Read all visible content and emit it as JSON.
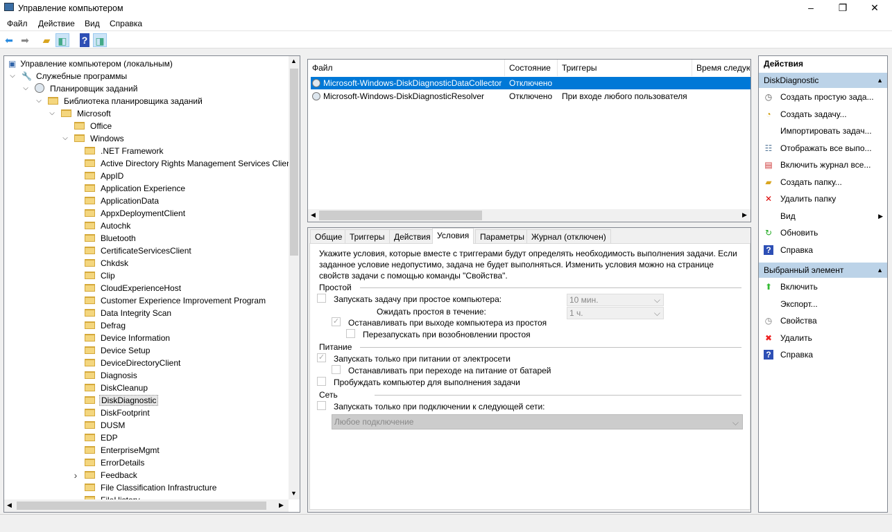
{
  "window": {
    "title": "Управление компьютером",
    "minimize": "–",
    "maximize": "❐",
    "close": "✕"
  },
  "menu": [
    "Файл",
    "Действие",
    "Вид",
    "Справка"
  ],
  "toolbar": {
    "icons": [
      "back-icon",
      "forward-icon",
      "up-folder-icon",
      "show-hide-tree-icon",
      "help-icon",
      "show-hide-actions-icon"
    ]
  },
  "tree": [
    {
      "label": "Управление компьютером (локальным)",
      "level": 0,
      "icon": "computer"
    },
    {
      "label": "Служебные программы",
      "level": 1,
      "icon": "tools",
      "expanded": true
    },
    {
      "label": "Планировщик заданий",
      "level": 2,
      "icon": "clock",
      "expanded": true
    },
    {
      "label": "Библиотека планировщика заданий",
      "level": 3,
      "icon": "folder-clock",
      "expanded": true
    },
    {
      "label": "Microsoft",
      "level": 4,
      "icon": "folder",
      "expanded": true
    },
    {
      "label": "Office",
      "level": 5,
      "icon": "folder"
    },
    {
      "label": "Windows",
      "level": 5,
      "icon": "folder",
      "expanded": true
    },
    {
      "label": ".NET Framework",
      "level": 6,
      "icon": "folder"
    },
    {
      "label": "Active Directory Rights Management Services Client",
      "level": 6,
      "icon": "folder"
    },
    {
      "label": "AppID",
      "level": 6,
      "icon": "folder"
    },
    {
      "label": "Application Experience",
      "level": 6,
      "icon": "folder"
    },
    {
      "label": "ApplicationData",
      "level": 6,
      "icon": "folder"
    },
    {
      "label": "AppxDeploymentClient",
      "level": 6,
      "icon": "folder"
    },
    {
      "label": "Autochk",
      "level": 6,
      "icon": "folder"
    },
    {
      "label": "Bluetooth",
      "level": 6,
      "icon": "folder"
    },
    {
      "label": "CertificateServicesClient",
      "level": 6,
      "icon": "folder"
    },
    {
      "label": "Chkdsk",
      "level": 6,
      "icon": "folder"
    },
    {
      "label": "Clip",
      "level": 6,
      "icon": "folder"
    },
    {
      "label": "CloudExperienceHost",
      "level": 6,
      "icon": "folder"
    },
    {
      "label": "Customer Experience Improvement Program",
      "level": 6,
      "icon": "folder"
    },
    {
      "label": "Data Integrity Scan",
      "level": 6,
      "icon": "folder"
    },
    {
      "label": "Defrag",
      "level": 6,
      "icon": "folder"
    },
    {
      "label": "Device Information",
      "level": 6,
      "icon": "folder"
    },
    {
      "label": "Device Setup",
      "level": 6,
      "icon": "folder"
    },
    {
      "label": "DeviceDirectoryClient",
      "level": 6,
      "icon": "folder"
    },
    {
      "label": "Diagnosis",
      "level": 6,
      "icon": "folder"
    },
    {
      "label": "DiskCleanup",
      "level": 6,
      "icon": "folder"
    },
    {
      "label": "DiskDiagnostic",
      "level": 6,
      "icon": "folder",
      "selected": true
    },
    {
      "label": "DiskFootprint",
      "level": 6,
      "icon": "folder"
    },
    {
      "label": "DUSM",
      "level": 6,
      "icon": "folder"
    },
    {
      "label": "EDP",
      "level": 6,
      "icon": "folder"
    },
    {
      "label": "EnterpriseMgmt",
      "level": 6,
      "icon": "folder"
    },
    {
      "label": "ErrorDetails",
      "level": 6,
      "icon": "folder"
    },
    {
      "label": "Feedback",
      "level": 6,
      "icon": "folder",
      "expanded": false
    },
    {
      "label": "File Classification Infrastructure",
      "level": 6,
      "icon": "folder"
    },
    {
      "label": "FileHistory",
      "level": 6,
      "icon": "folder"
    }
  ],
  "tasks": {
    "columns": [
      "Файл",
      "Состояние",
      "Триггеры",
      "Время следую"
    ],
    "rows": [
      {
        "name": "Microsoft-Windows-DiskDiagnosticDataCollector",
        "state": "Отключено",
        "triggers": "",
        "selected": true
      },
      {
        "name": "Microsoft-Windows-DiskDiagnosticResolver",
        "state": "Отключено",
        "triggers": "При входе любого пользователя"
      }
    ]
  },
  "tabs": [
    {
      "label": "Общие"
    },
    {
      "label": "Триггеры"
    },
    {
      "label": "Действия"
    },
    {
      "label": "Условия",
      "active": true
    },
    {
      "label": "Параметры"
    },
    {
      "label": "Журнал (отключен)"
    }
  ],
  "conditions": {
    "intro": [
      "Укажите условия, которые вместе с триггерами будут определять необходимость выполнения задачи.  Если",
      "заданное условие недопустимо, задача не будет выполняться.  Изменить условия можно на странице",
      "свойств задачи с помощью команды \"Свойства\"."
    ],
    "idle": {
      "title": "Простой",
      "start_idle": {
        "label": "Запускать задачу при простое компьютера:",
        "checked": false,
        "value": "10 мин."
      },
      "wait_label": "Ожидать простоя в течение:",
      "wait_value": "1 ч.",
      "stop_on_exit": {
        "label": "Останавливать при выходе компьютера из простоя",
        "checked": true
      },
      "restart": {
        "label": "Перезапускать при возобновлении простоя",
        "checked": false
      }
    },
    "power": {
      "title": "Питание",
      "ac_only": {
        "label": "Запускать только при питании от электросети",
        "checked": true
      },
      "stop_battery": {
        "label": "Останавливать при переходе на питание от батарей",
        "checked": false
      },
      "wake": {
        "label": "Пробуждать компьютер для выполнения задачи",
        "checked": false
      }
    },
    "network": {
      "title": "Сеть",
      "only_network": {
        "label": "Запускать только при подключении к следующей сети:",
        "checked": false
      },
      "network_value": "Любое подключение"
    }
  },
  "actions": {
    "title": "Действия",
    "section1": {
      "title": "DiskDiagnostic",
      "items": [
        {
          "label": "Создать простую зада...",
          "icon": "create-basic-task-icon"
        },
        {
          "label": "Создать задачу...",
          "icon": "create-task-icon"
        },
        {
          "label": "Импортировать задач...",
          "icon": ""
        },
        {
          "label": "Отображать все выпо...",
          "icon": "display-running-icon"
        },
        {
          "label": "Включить журнал все...",
          "icon": "enable-log-icon"
        },
        {
          "label": "Создать папку...",
          "icon": "new-folder-icon"
        },
        {
          "label": "Удалить папку",
          "icon": "delete-folder-icon"
        },
        {
          "label": "Вид",
          "icon": "",
          "submenu": true
        },
        {
          "label": "Обновить",
          "icon": "refresh-icon"
        },
        {
          "label": "Справка",
          "icon": "help-icon"
        }
      ]
    },
    "section2": {
      "title": "Выбранный элемент",
      "items": [
        {
          "label": "Включить",
          "icon": "enable-icon"
        },
        {
          "label": "Экспорт...",
          "icon": ""
        },
        {
          "label": "Свойства",
          "icon": "properties-icon"
        },
        {
          "label": "Удалить",
          "icon": "delete-icon"
        },
        {
          "label": "Справка",
          "icon": "help-icon"
        }
      ]
    }
  },
  "colors": {
    "selection": "#0078d7",
    "action_header": "#bcd3e8"
  }
}
